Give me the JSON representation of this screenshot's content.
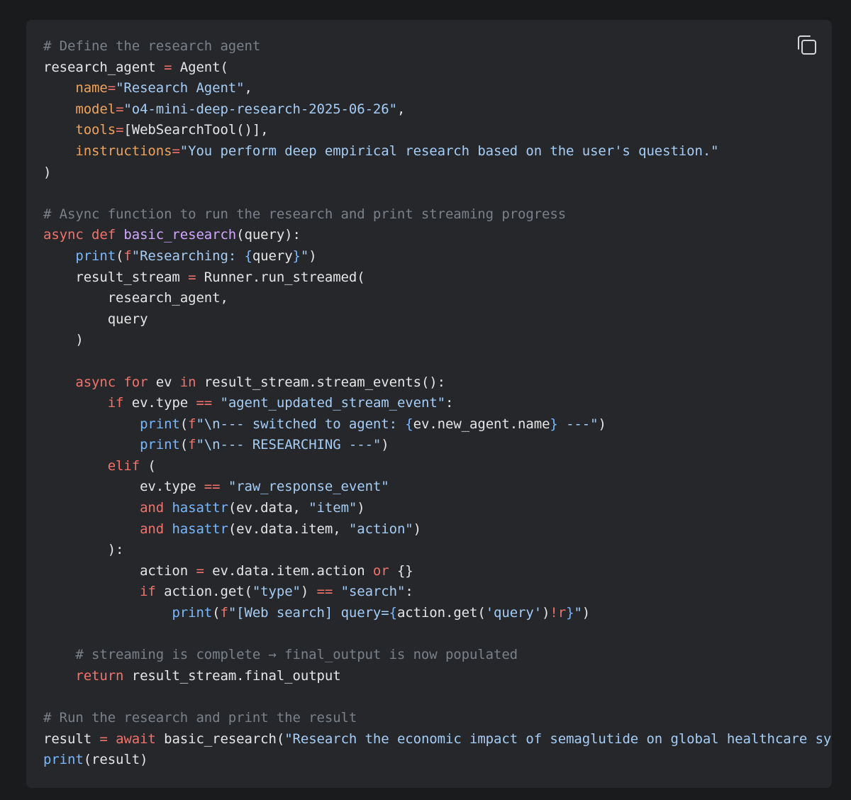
{
  "copy_button": {
    "icon": "copy-icon",
    "tooltip": "Copy"
  },
  "code": {
    "language": "python",
    "lines": [
      [
        [
          "cm",
          "# Define the research agent"
        ]
      ],
      [
        [
          "id",
          "research_agent "
        ],
        [
          "op",
          "="
        ],
        [
          "id",
          " Agent("
        ]
      ],
      [
        [
          "id",
          "    "
        ],
        [
          "arg",
          "name"
        ],
        [
          "op",
          "="
        ],
        [
          "str",
          "\"Research Agent\""
        ],
        [
          "id",
          ","
        ]
      ],
      [
        [
          "id",
          "    "
        ],
        [
          "arg",
          "model"
        ],
        [
          "op",
          "="
        ],
        [
          "str",
          "\"o4-mini-deep-research-2025-06-26\""
        ],
        [
          "id",
          ","
        ]
      ],
      [
        [
          "id",
          "    "
        ],
        [
          "arg",
          "tools"
        ],
        [
          "op",
          "="
        ],
        [
          "id",
          "[WebSearchTool()],"
        ]
      ],
      [
        [
          "id",
          "    "
        ],
        [
          "arg",
          "instructions"
        ],
        [
          "op",
          "="
        ],
        [
          "str",
          "\"You perform deep empirical research based on the user's question.\""
        ]
      ],
      [
        [
          "id",
          ")"
        ]
      ],
      [],
      [
        [
          "cm",
          "# Async function to run the research and print streaming progress"
        ]
      ],
      [
        [
          "kw",
          "async def "
        ],
        [
          "fn",
          "basic_research"
        ],
        [
          "id",
          "(query):"
        ]
      ],
      [
        [
          "id",
          "    "
        ],
        [
          "bi",
          "print"
        ],
        [
          "id",
          "("
        ],
        [
          "kw",
          "f"
        ],
        [
          "str",
          "\"Researching: "
        ],
        [
          "bi",
          "{"
        ],
        [
          "id",
          "query"
        ],
        [
          "bi",
          "}"
        ],
        [
          "str",
          "\""
        ],
        [
          "id",
          ")"
        ]
      ],
      [
        [
          "id",
          "    result_stream "
        ],
        [
          "op",
          "="
        ],
        [
          "id",
          " Runner.run_streamed("
        ]
      ],
      [
        [
          "id",
          "        research_agent,"
        ]
      ],
      [
        [
          "id",
          "        query"
        ]
      ],
      [
        [
          "id",
          "    )"
        ]
      ],
      [],
      [
        [
          "id",
          "    "
        ],
        [
          "kw",
          "async for"
        ],
        [
          "id",
          " ev "
        ],
        [
          "kw",
          "in"
        ],
        [
          "id",
          " result_stream.stream_events():"
        ]
      ],
      [
        [
          "id",
          "        "
        ],
        [
          "kw",
          "if"
        ],
        [
          "id",
          " ev.type "
        ],
        [
          "op",
          "=="
        ],
        [
          "id",
          " "
        ],
        [
          "str",
          "\"agent_updated_stream_event\""
        ],
        [
          "id",
          ":"
        ]
      ],
      [
        [
          "id",
          "            "
        ],
        [
          "bi",
          "print"
        ],
        [
          "id",
          "("
        ],
        [
          "kw",
          "f"
        ],
        [
          "str",
          "\"\\n--- switched to agent: "
        ],
        [
          "bi",
          "{"
        ],
        [
          "id",
          "ev.new_agent.name"
        ],
        [
          "bi",
          "}"
        ],
        [
          "str",
          " ---\""
        ],
        [
          "id",
          ")"
        ]
      ],
      [
        [
          "id",
          "            "
        ],
        [
          "bi",
          "print"
        ],
        [
          "id",
          "("
        ],
        [
          "kw",
          "f"
        ],
        [
          "str",
          "\"\\n--- RESEARCHING ---\""
        ],
        [
          "id",
          ")"
        ]
      ],
      [
        [
          "id",
          "        "
        ],
        [
          "kw",
          "elif"
        ],
        [
          "id",
          " ("
        ]
      ],
      [
        [
          "id",
          "            ev.type "
        ],
        [
          "op",
          "=="
        ],
        [
          "id",
          " "
        ],
        [
          "str",
          "\"raw_response_event\""
        ]
      ],
      [
        [
          "id",
          "            "
        ],
        [
          "kw",
          "and"
        ],
        [
          "id",
          " "
        ],
        [
          "bi",
          "hasattr"
        ],
        [
          "id",
          "(ev.data, "
        ],
        [
          "str",
          "\"item\""
        ],
        [
          "id",
          ")"
        ]
      ],
      [
        [
          "id",
          "            "
        ],
        [
          "kw",
          "and"
        ],
        [
          "id",
          " "
        ],
        [
          "bi",
          "hasattr"
        ],
        [
          "id",
          "(ev.data.item, "
        ],
        [
          "str",
          "\"action\""
        ],
        [
          "id",
          ")"
        ]
      ],
      [
        [
          "id",
          "        ):"
        ]
      ],
      [
        [
          "id",
          "            action "
        ],
        [
          "op",
          "="
        ],
        [
          "id",
          " ev.data.item.action "
        ],
        [
          "kw",
          "or"
        ],
        [
          "id",
          " {}"
        ]
      ],
      [
        [
          "id",
          "            "
        ],
        [
          "kw",
          "if"
        ],
        [
          "id",
          " action.get("
        ],
        [
          "str",
          "\"type\""
        ],
        [
          "id",
          ") "
        ],
        [
          "op",
          "=="
        ],
        [
          "id",
          " "
        ],
        [
          "str",
          "\"search\""
        ],
        [
          "id",
          ":"
        ]
      ],
      [
        [
          "id",
          "                "
        ],
        [
          "bi",
          "print"
        ],
        [
          "id",
          "("
        ],
        [
          "kw",
          "f"
        ],
        [
          "str",
          "\"[Web search] query="
        ],
        [
          "bi",
          "{"
        ],
        [
          "id",
          "action.get("
        ],
        [
          "str",
          "'query'"
        ],
        [
          "id",
          ")"
        ],
        [
          "kw",
          "!r"
        ],
        [
          "bi",
          "}"
        ],
        [
          "str",
          "\""
        ],
        [
          "id",
          ")"
        ]
      ],
      [],
      [
        [
          "cm",
          "    # streaming is complete → final_output is now populated"
        ]
      ],
      [
        [
          "id",
          "    "
        ],
        [
          "kw",
          "return"
        ],
        [
          "id",
          " result_stream.final_output"
        ]
      ],
      [],
      [
        [
          "cm",
          "# Run the research and print the result"
        ]
      ],
      [
        [
          "id",
          "result "
        ],
        [
          "op",
          "="
        ],
        [
          "id",
          " "
        ],
        [
          "kw",
          "await"
        ],
        [
          "id",
          " basic_research("
        ],
        [
          "str",
          "\"Research the economic impact of semaglutide on global healthcare sy"
        ]
      ],
      [
        [
          "bi",
          "print"
        ],
        [
          "id",
          "(result)"
        ]
      ]
    ]
  },
  "colors": {
    "page_background": "#1a1b1d",
    "card_background": "#25272b",
    "comment": "#7b8189",
    "keyword": "#f2736b",
    "argument": "#f0a35c",
    "string": "#a5cdf5",
    "function": "#d2a8ff",
    "builtin": "#79b8ff",
    "text": "#e6e6e6"
  }
}
